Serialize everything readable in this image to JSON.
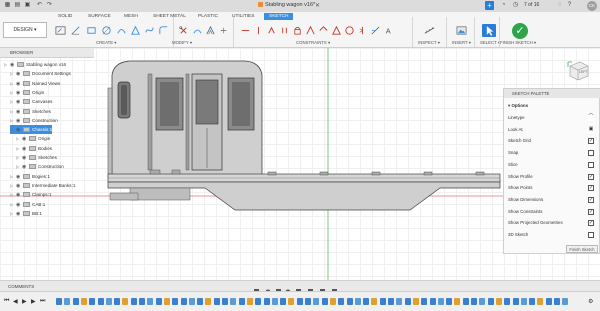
{
  "window": {
    "doc_title": "Stabling wagon v16*",
    "tab_count": "7 of 16",
    "user_initials": "CK"
  },
  "ribbon": {
    "workspace_btn": "DESIGN ▾",
    "tabs": [
      "SOLID",
      "SURFACE",
      "MESH",
      "SHEET METAL",
      "PLASTIC",
      "UTILITIES",
      "SKETCH"
    ],
    "groups": [
      "CREATE ▾",
      "MODIFY ▾",
      "CONSTRAINTS ▾",
      "INSPECT ▾",
      "INSERT ▾",
      "SELECT ▾",
      "FINISH SKETCH ▾"
    ]
  },
  "browser": {
    "title": "BROWSER",
    "items": [
      {
        "label": "Stabling wagon v16",
        "indent": 0
      },
      {
        "label": "Document Settings",
        "indent": 1
      },
      {
        "label": "Named Views",
        "indent": 1
      },
      {
        "label": "Origin",
        "indent": 1
      },
      {
        "label": "Canvases",
        "indent": 1
      },
      {
        "label": "Sketches",
        "indent": 1
      },
      {
        "label": "Construction",
        "indent": 1
      },
      {
        "label": "Chassis:1",
        "indent": 1,
        "selected": true
      },
      {
        "label": "Origin",
        "indent": 2
      },
      {
        "label": "Bodies",
        "indent": 2
      },
      {
        "label": "Sketches",
        "indent": 2
      },
      {
        "label": "Construction",
        "indent": 2
      },
      {
        "label": "Bogies:1",
        "indent": 1
      },
      {
        "label": "Intermediate Banks:1",
        "indent": 1
      },
      {
        "label": "Clamps:1",
        "indent": 1
      },
      {
        "label": "CAB:1",
        "indent": 1
      },
      {
        "label": "BB:1",
        "indent": 1
      }
    ]
  },
  "palette": {
    "title": "SKETCH PALETTE",
    "section": "Options",
    "rows": [
      {
        "label": "Linetype",
        "checked": null
      },
      {
        "label": "Look At",
        "checked": null
      },
      {
        "label": "Sketch Grid",
        "checked": true
      },
      {
        "label": "Snap",
        "checked": false
      },
      {
        "label": "Slice",
        "checked": false
      },
      {
        "label": "Show Profile",
        "checked": true
      },
      {
        "label": "Show Points",
        "checked": true
      },
      {
        "label": "Show Dimensions",
        "checked": true
      },
      {
        "label": "Show Constraints",
        "checked": true
      },
      {
        "label": "Show Projected Geometries",
        "checked": true
      },
      {
        "label": "3D Sketch",
        "checked": false
      }
    ],
    "finish_btn": "Finish Sketch"
  },
  "viewcube": {
    "face": "LEFT"
  },
  "comments": {
    "title": "COMMENTS"
  },
  "colors": {
    "accent": "#3b8fe0",
    "finish": "#2fa44a",
    "timeline_blue": "#3b7fcf"
  }
}
